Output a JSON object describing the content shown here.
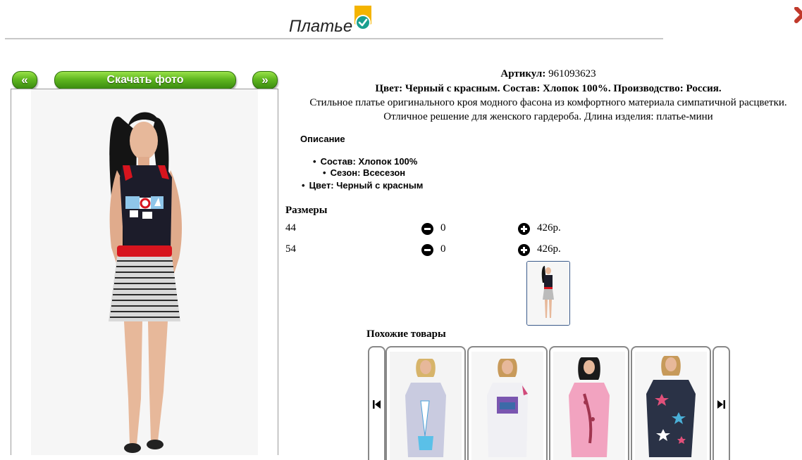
{
  "header": {
    "title": "Платье",
    "badge_icon": "verified-check-icon",
    "badge_color": "#f4b400",
    "check_color": "#1a9f8f"
  },
  "gallery": {
    "prev_label": "«",
    "download_label": "Скачать фото",
    "next_label": "»",
    "button_color": "#5fb71f"
  },
  "product": {
    "article_label": "Артикул:",
    "article_value": "961093623",
    "details": "Цвет: Черный с красным. Состав: Хлопок 100%. Производство: Россия.",
    "description_line1": "Стильное платье оригинального кроя модного фасона из комфортного материала симпатичной расцветки.",
    "description_line2": "Отличное решение для женского гардероба. Длина изделия: платье-мини"
  },
  "description": {
    "heading": "Описание",
    "items": [
      "Состав: Хлопок 100%",
      "Сезон: Всесезон",
      "Цвет: Черный с красным"
    ]
  },
  "sizes": {
    "heading": "Размеры",
    "rows": [
      {
        "size": "44",
        "quantity": "0",
        "price": "426р."
      },
      {
        "size": "54",
        "quantity": "0",
        "price": "426р."
      }
    ]
  },
  "similar": {
    "heading": "Похожие товары",
    "prev_icon": "skip-back-icon",
    "next_icon": "skip-forward-icon"
  }
}
